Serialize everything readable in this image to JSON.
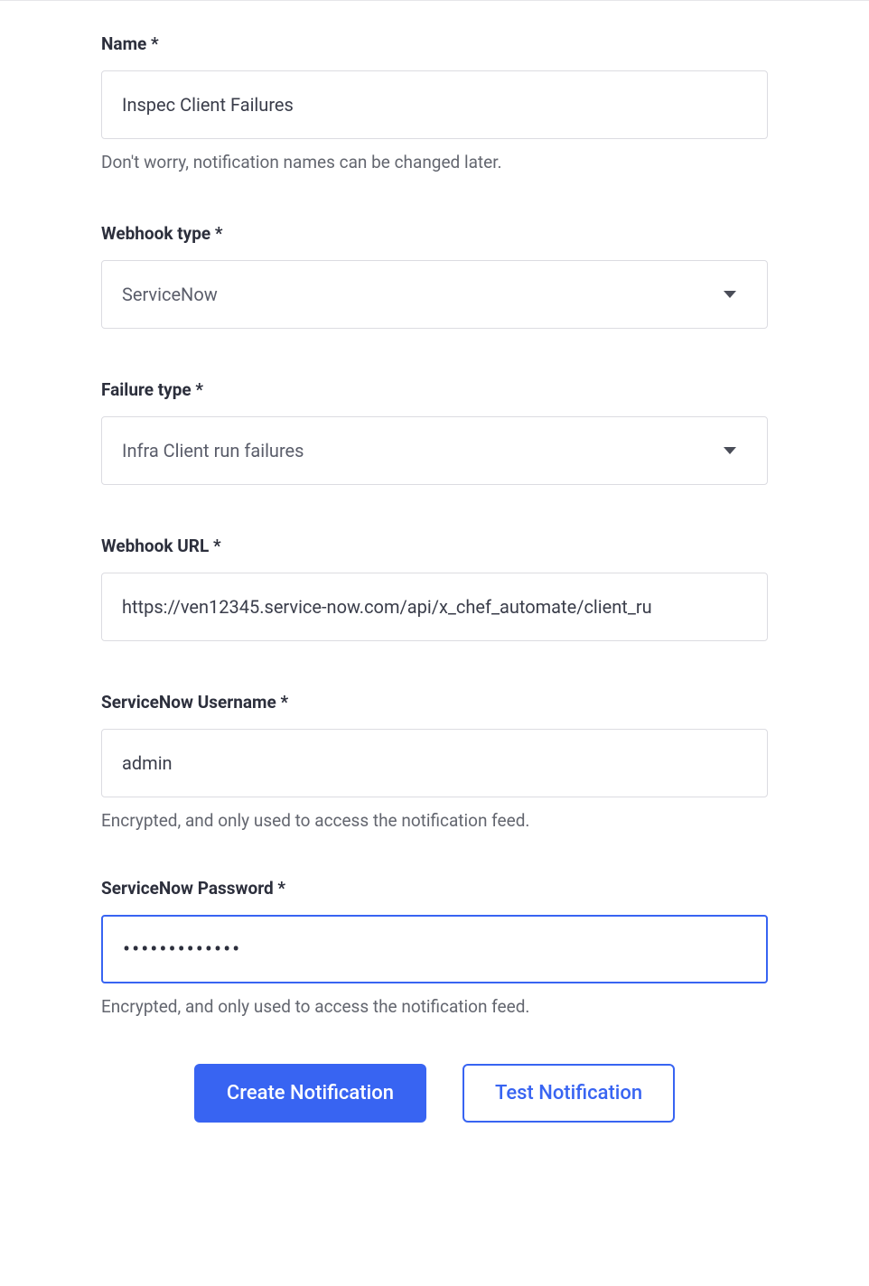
{
  "fields": {
    "name": {
      "label": "Name *",
      "value": "Inspec Client Failures",
      "helper": "Don't worry, notification names can be changed later."
    },
    "webhook_type": {
      "label": "Webhook type *",
      "value": "ServiceNow"
    },
    "failure_type": {
      "label": "Failure type *",
      "value": "Infra Client run failures"
    },
    "webhook_url": {
      "label": "Webhook URL *",
      "value": "https://ven12345.service-now.com/api/x_chef_automate/client_ru"
    },
    "username": {
      "label": "ServiceNow Username *",
      "value": "admin",
      "helper": "Encrypted, and only used to access the notification feed."
    },
    "password": {
      "label": "ServiceNow Password *",
      "value": "•••••••••••••",
      "helper": "Encrypted, and only used to access the notification feed."
    }
  },
  "buttons": {
    "create": "Create Notification",
    "test": "Test Notification"
  }
}
